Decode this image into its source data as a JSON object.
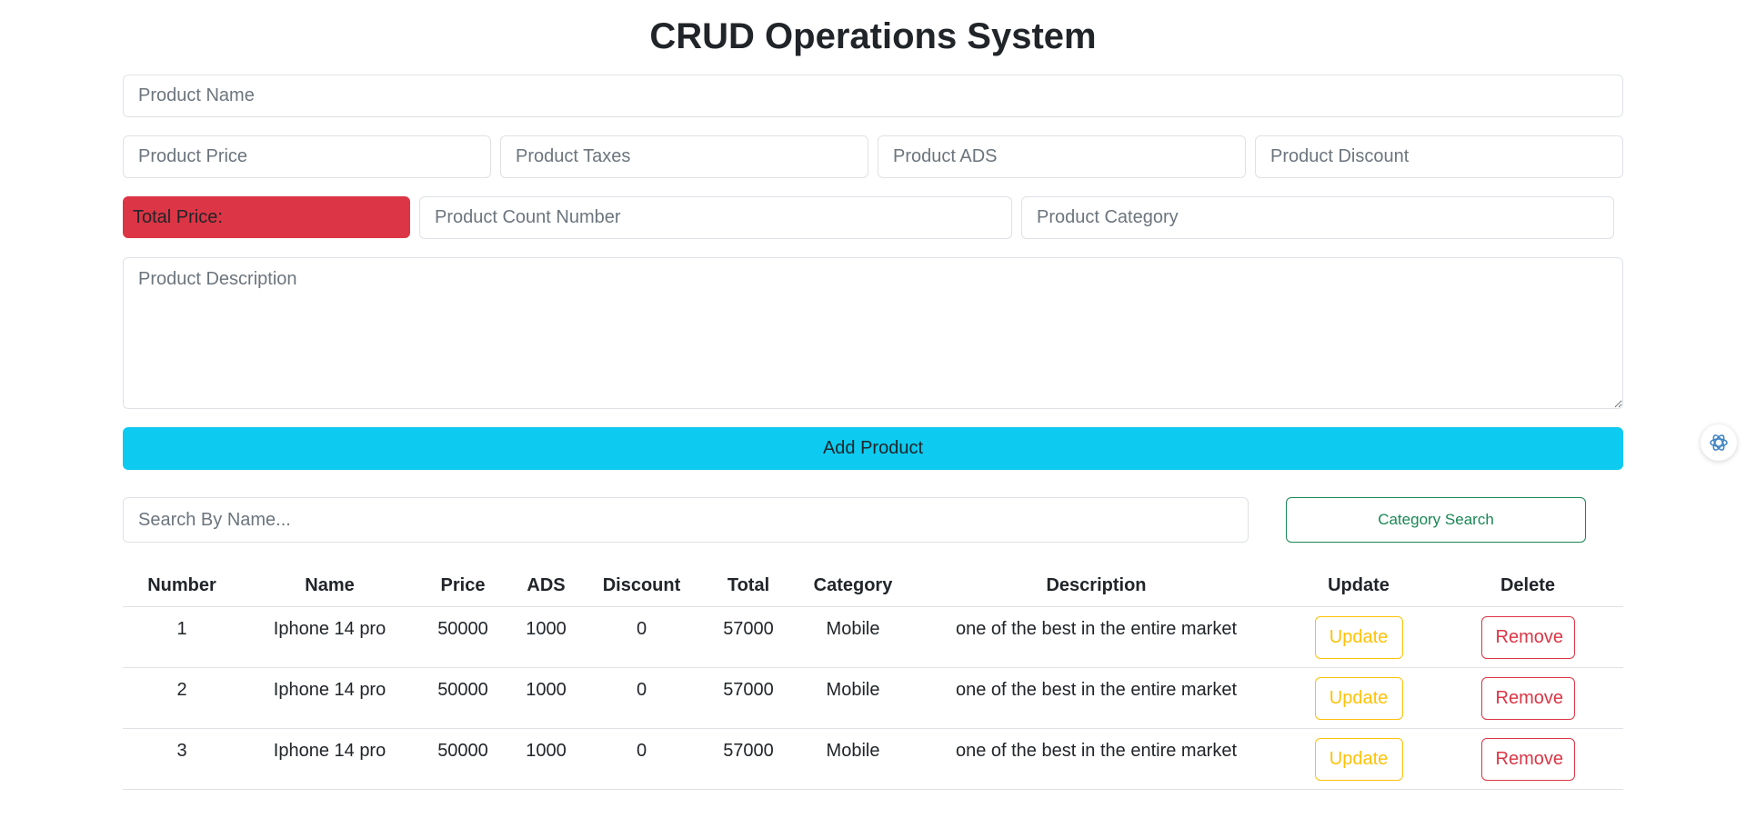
{
  "page_title": "CRUD Operations System",
  "form": {
    "name_placeholder": "Product Name",
    "price_placeholder": "Product Price",
    "taxes_placeholder": "Product Taxes",
    "ads_placeholder": "Product ADS",
    "discount_placeholder": "Product Discount",
    "total_label": "Total Price:",
    "count_placeholder": "Product Count Number",
    "category_placeholder": "Product Category",
    "description_placeholder": "Product Description",
    "add_button_label": "Add Product"
  },
  "search": {
    "placeholder": "Search By Name...",
    "category_button_label": "Category Search"
  },
  "table": {
    "headers": [
      "Number",
      "Name",
      "Price",
      "ADS",
      "Discount",
      "Total",
      "Category",
      "Description",
      "Update",
      "Delete"
    ],
    "rows": [
      {
        "number": "1",
        "name": "Iphone 14 pro",
        "price": "50000",
        "ads": "1000",
        "discount": "0",
        "total": "57000",
        "category": "Mobile",
        "description": "one of the best in the entire market",
        "update_label": "Update",
        "remove_label": "Remove"
      },
      {
        "number": "2",
        "name": "Iphone 14 pro",
        "price": "50000",
        "ads": "1000",
        "discount": "0",
        "total": "57000",
        "category": "Mobile",
        "description": "one of the best in the entire market",
        "update_label": "Update",
        "remove_label": "Remove"
      },
      {
        "number": "3",
        "name": "Iphone 14 pro",
        "price": "50000",
        "ads": "1000",
        "discount": "0",
        "total": "57000",
        "category": "Mobile",
        "description": "one of the best in the entire market",
        "update_label": "Update",
        "remove_label": "Remove"
      }
    ]
  },
  "side_widget": {
    "icon": "assistant-icon"
  },
  "colors": {
    "total_bg": "#dc3545",
    "add_button_bg": "#0dcaf0",
    "category_button": "#198754",
    "update_button": "#ffc107",
    "remove_button": "#dc3545"
  }
}
